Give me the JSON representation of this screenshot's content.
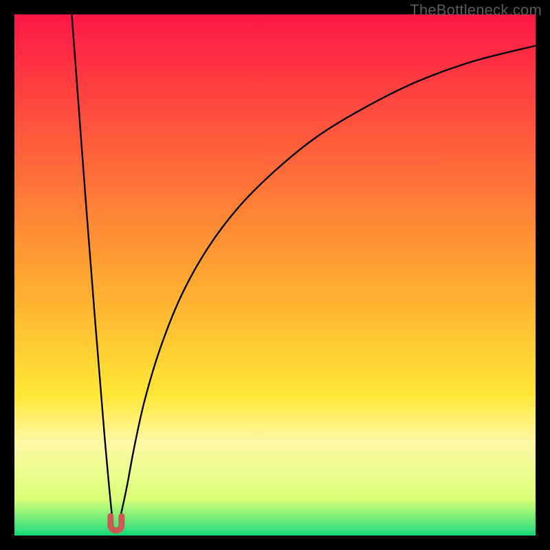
{
  "watermark": "TheBottleneck.com",
  "chart_data": {
    "type": "line",
    "title": "",
    "xlabel": "",
    "ylabel": "",
    "xlim": [
      0,
      100
    ],
    "ylim": [
      0,
      100
    ],
    "grid": false,
    "legend": false,
    "background": {
      "type": "vertical-gradient",
      "stops": [
        {
          "pos": 0,
          "color": "#ff1746"
        },
        {
          "pos": 50,
          "color": "#ffa531"
        },
        {
          "pos": 73,
          "color": "#ffe735"
        },
        {
          "pos": 82,
          "color": "#fff8a6"
        },
        {
          "pos": 93,
          "color": "#d9ff77"
        },
        {
          "pos": 99,
          "color": "#33e07a"
        },
        {
          "pos": 100,
          "color": "#0fd56d"
        }
      ]
    },
    "marker": {
      "shape": "u",
      "x": 19.5,
      "y": 2,
      "color": "#cc5a52"
    },
    "series": [
      {
        "name": "left-branch",
        "x": [
          11.0,
          11.9,
          12.8,
          13.7,
          14.6,
          15.5,
          16.4,
          17.3,
          18.2,
          18.8
        ],
        "y": [
          100,
          88,
          76,
          64,
          52.5,
          41,
          30,
          19,
          9,
          3
        ]
      },
      {
        "name": "right-branch",
        "x": [
          20.2,
          21.5,
          23,
          25,
          28,
          32,
          37,
          43,
          50,
          58,
          67,
          77,
          88,
          100
        ],
        "y": [
          3,
          9,
          17,
          26,
          36,
          46,
          55,
          63,
          70,
          76.5,
          82,
          87,
          91,
          94
        ]
      }
    ]
  }
}
